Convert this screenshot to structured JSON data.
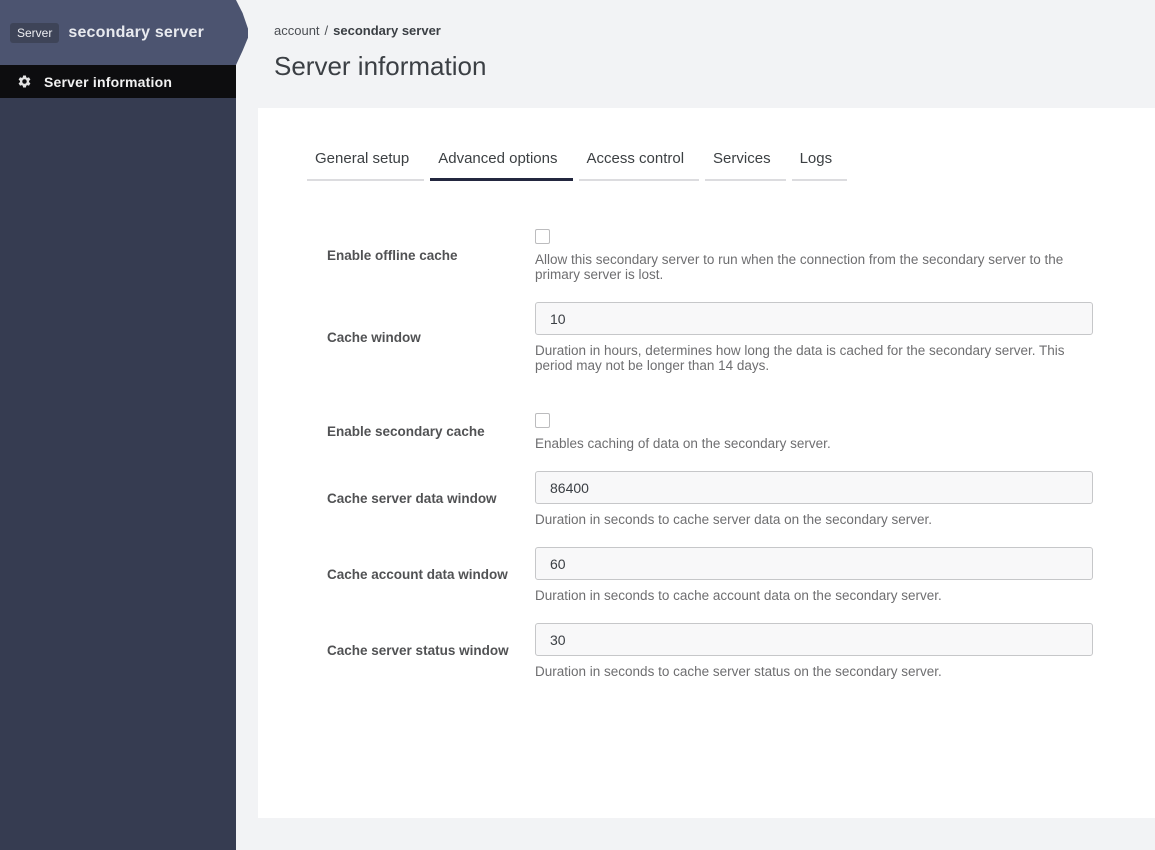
{
  "sidebar": {
    "badge": "Server",
    "title": "secondary server",
    "menu_item": "Server information",
    "menu_icon": "gear-icon"
  },
  "breadcrumb": {
    "parent": "account",
    "separator": "/",
    "current": "secondary server"
  },
  "page_title": "Server information",
  "tabs": [
    {
      "label": "General setup",
      "active": false
    },
    {
      "label": "Advanced options",
      "active": true
    },
    {
      "label": "Access control",
      "active": false
    },
    {
      "label": "Services",
      "active": false
    },
    {
      "label": "Logs",
      "active": false
    }
  ],
  "form": {
    "rows": [
      {
        "type": "checkbox",
        "label": "Enable offline cache",
        "checked": false,
        "help": "Allow this secondary server to run when the connection from the secondary server to the primary server is lost."
      },
      {
        "type": "text",
        "label": "Cache window",
        "value": "10",
        "help": "Duration in hours, determines how long the data is cached for the secondary server. This period may not be longer than 14 days."
      },
      {
        "type": "checkbox",
        "label": "Enable secondary cache",
        "checked": false,
        "section_gap": true,
        "help": "Enables caching of data on the secondary server."
      },
      {
        "type": "text",
        "label": "Cache server data window",
        "value": "86400",
        "help": "Duration in seconds to cache server data on the secondary server."
      },
      {
        "type": "text",
        "label": "Cache account data window",
        "value": "60",
        "help": "Duration in seconds to cache account data on the secondary server."
      },
      {
        "type": "text",
        "label": "Cache server status window",
        "value": "30",
        "help": "Duration in seconds to cache server status on the secondary server."
      }
    ]
  },
  "colors": {
    "sidebar_bg": "#363c51",
    "sidebar_header_bg": "#4c5470",
    "badge_bg": "#3e4458",
    "menu_bg": "#0d0d0f",
    "main_bg": "#f2f3f5",
    "card_bg": "#ffffff",
    "text_dark": "#3b3f44",
    "label_color": "#515254",
    "help_color": "#6e6e70",
    "input_bg": "#f8f8f9",
    "input_border": "#c6c7c9",
    "tab_underline": "#dcdcdf",
    "tab_active_underline": "#23273f",
    "checkbox_border": "#bcbcbe"
  }
}
